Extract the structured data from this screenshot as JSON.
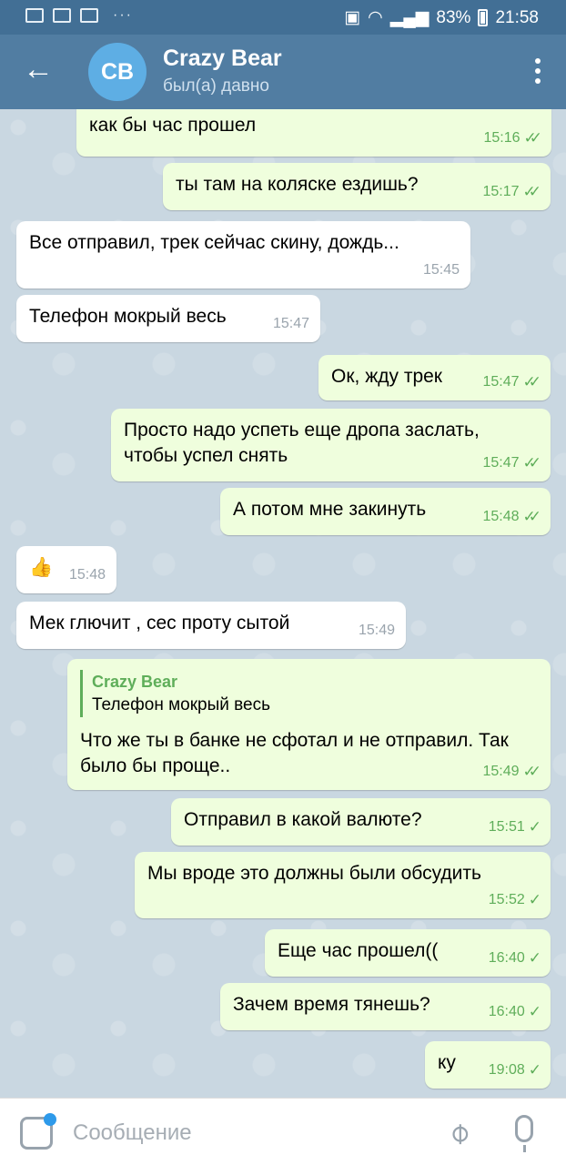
{
  "status_bar": {
    "battery": "83%",
    "time": "21:58",
    "dots": "···"
  },
  "header": {
    "avatar_initials": "CB",
    "contact_name": "Crazy Bear",
    "contact_status": "был(а) давно"
  },
  "messages": [
    {
      "text": "как бы час прошел",
      "time": "15:16",
      "dir": "out",
      "check": "✓✓"
    },
    {
      "text": "ты там на коляске ездишь?",
      "time": "15:17",
      "dir": "out",
      "check": "✓✓"
    },
    {
      "text": "Все отправил, трек сейчас скину, дождь...",
      "time": "15:45",
      "dir": "in"
    },
    {
      "text": "Телефон мокрый весь",
      "time": "15:47",
      "dir": "in"
    },
    {
      "text": "Ок, жду трек",
      "time": "15:47",
      "dir": "out",
      "check": "✓✓"
    },
    {
      "text": "Просто надо успеть еще дропа заслать, чтобы успел снять",
      "time": "15:47",
      "dir": "out",
      "check": "✓✓"
    },
    {
      "text": "А потом мне закинуть",
      "time": "15:48",
      "dir": "out",
      "check": "✓✓"
    },
    {
      "text": "👍",
      "time": "15:48",
      "dir": "in"
    },
    {
      "text": "Мек глючит , сес проту сытой",
      "time": "15:49",
      "dir": "in"
    },
    {
      "text": "Что же ты в банке не сфотал и не отправил. Так было бы проще..",
      "time": "15:49",
      "dir": "out",
      "check": "✓✓",
      "reply_name": "Crazy Bear",
      "reply_text": "Телефон мокрый весь"
    },
    {
      "text": "Отправил в какой валюте?",
      "time": "15:51",
      "dir": "out",
      "check": "✓"
    },
    {
      "text": "Мы вроде это должны были обсудить",
      "time": "15:52",
      "dir": "out",
      "check": "✓"
    },
    {
      "text": "Еще час прошел((",
      "time": "16:40",
      "dir": "out",
      "check": "✓"
    },
    {
      "text": "Зачем время тянешь?",
      "time": "16:40",
      "dir": "out",
      "check": "✓"
    },
    {
      "text": "ку",
      "time": "19:08",
      "dir": "out",
      "check": "✓"
    }
  ],
  "composer": {
    "placeholder": "Сообщение"
  }
}
